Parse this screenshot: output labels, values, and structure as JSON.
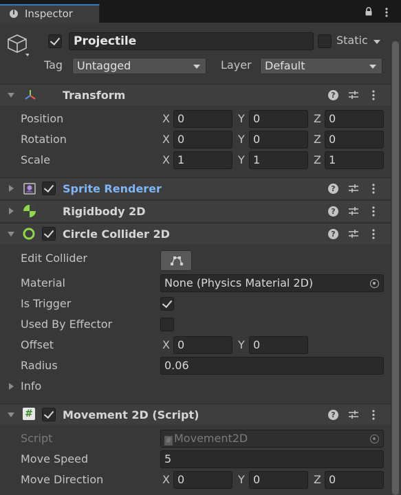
{
  "tab": {
    "title": "Inspector"
  },
  "object": {
    "name": "Projectile",
    "active": true,
    "static_label": "Static",
    "static_checked": false,
    "tag_label": "Tag",
    "tag_value": "Untagged",
    "layer_label": "Layer",
    "layer_value": "Default"
  },
  "transform": {
    "title": "Transform",
    "position": {
      "label": "Position",
      "x": "0",
      "y": "0",
      "z": "0"
    },
    "rotation": {
      "label": "Rotation",
      "x": "0",
      "y": "0",
      "z": "0"
    },
    "scale": {
      "label": "Scale",
      "x": "1",
      "y": "1",
      "z": "1"
    },
    "axes": {
      "x": "X",
      "y": "Y",
      "z": "Z"
    }
  },
  "sprite_renderer": {
    "title": "Sprite Renderer",
    "enabled": true
  },
  "rigidbody": {
    "title": "Rigidbody 2D"
  },
  "circle_collider": {
    "title": "Circle Collider 2D",
    "enabled": true,
    "edit_collider_label": "Edit Collider",
    "material_label": "Material",
    "material_value": "None (Physics Material 2D)",
    "is_trigger_label": "Is Trigger",
    "is_trigger": true,
    "used_by_effector_label": "Used By Effector",
    "used_by_effector": false,
    "offset_label": "Offset",
    "offset_x": "0",
    "offset_y": "0",
    "radius_label": "Radius",
    "radius_value": "0.06",
    "info_label": "Info"
  },
  "movement": {
    "title": "Movement 2D (Script)",
    "enabled": true,
    "script_label": "Script",
    "script_value": "Movement2D",
    "move_speed_label": "Move Speed",
    "move_speed_value": "5",
    "move_direction_label": "Move Direction",
    "dir_x": "0",
    "dir_y": "0",
    "dir_z": "0"
  },
  "icons": {
    "help": "?",
    "hash": "#"
  },
  "colors": {
    "accent_tab": "#3a79bb",
    "sprite_title": "#7fb4f5",
    "collider_icon": "#8ed948"
  }
}
